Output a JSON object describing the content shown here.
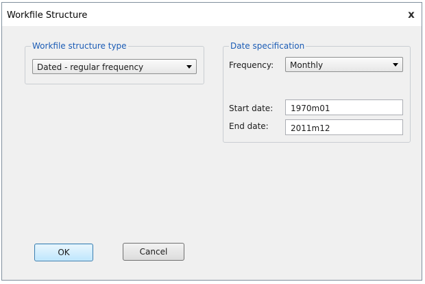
{
  "window": {
    "title": "Workfile Structure",
    "close_glyph": "x"
  },
  "structure_group": {
    "legend": "Workfile structure type",
    "selected": "Dated - regular frequency"
  },
  "date_group": {
    "legend": "Date specification",
    "frequency_label": "Frequency:",
    "frequency_value": "Monthly",
    "start_label": "Start date:",
    "start_value": "1970m01",
    "end_label": "End date:",
    "end_value": "2011m12"
  },
  "buttons": {
    "ok": "OK",
    "cancel": "Cancel"
  }
}
